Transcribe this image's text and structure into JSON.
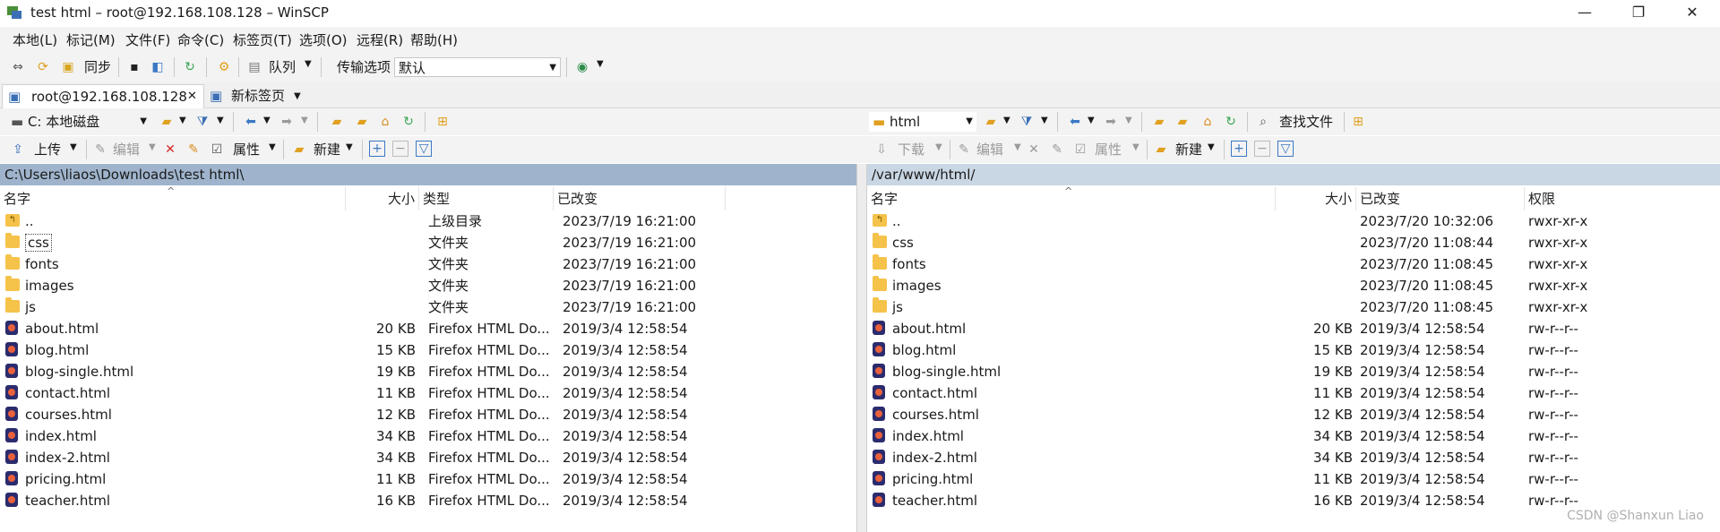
{
  "window": {
    "title": "test html – root@192.168.108.128 – WinSCP",
    "minimize": "—",
    "maximize": "❐",
    "close": "✕"
  },
  "menu": [
    "本地(L)",
    "标记(M)",
    "文件(F)",
    "命令(C)",
    "标签页(T)",
    "选项(O)",
    "远程(R)",
    "帮助(H)"
  ],
  "toolbar": {
    "sync_label": "同步",
    "queue_label": "队列",
    "transfer_label": "传输选项",
    "transfer_value": "默认"
  },
  "tabs": [
    {
      "label": "root@192.168.108.128",
      "close": "✕"
    },
    {
      "label": "新标签页"
    }
  ],
  "local": {
    "drive": "C: 本地磁盘",
    "upload_label": "上传",
    "edit_label": "编辑",
    "properties_label": "属性",
    "new_label": "新建",
    "path": "C:\\Users\\liaos\\Downloads\\test html\\",
    "columns": {
      "name": "名字",
      "size": "大小",
      "type": "类型",
      "changed": "已改变"
    },
    "files": [
      {
        "name": "..",
        "size": "",
        "type": "上级目录",
        "changed": "2023/7/19 16:21:00",
        "kind": "up"
      },
      {
        "name": "css",
        "size": "",
        "type": "文件夹",
        "changed": "2023/7/19 16:21:00",
        "kind": "folder"
      },
      {
        "name": "fonts",
        "size": "",
        "type": "文件夹",
        "changed": "2023/7/19 16:21:00",
        "kind": "folder"
      },
      {
        "name": "images",
        "size": "",
        "type": "文件夹",
        "changed": "2023/7/19 16:21:00",
        "kind": "folder"
      },
      {
        "name": "js",
        "size": "",
        "type": "文件夹",
        "changed": "2023/7/19 16:21:00",
        "kind": "folder"
      },
      {
        "name": "about.html",
        "size": "20 KB",
        "type": "Firefox HTML Do...",
        "changed": "2019/3/4 12:58:54",
        "kind": "html"
      },
      {
        "name": "blog.html",
        "size": "15 KB",
        "type": "Firefox HTML Do...",
        "changed": "2019/3/4 12:58:54",
        "kind": "html"
      },
      {
        "name": "blog-single.html",
        "size": "19 KB",
        "type": "Firefox HTML Do...",
        "changed": "2019/3/4 12:58:54",
        "kind": "html"
      },
      {
        "name": "contact.html",
        "size": "11 KB",
        "type": "Firefox HTML Do...",
        "changed": "2019/3/4 12:58:54",
        "kind": "html"
      },
      {
        "name": "courses.html",
        "size": "12 KB",
        "type": "Firefox HTML Do...",
        "changed": "2019/3/4 12:58:54",
        "kind": "html"
      },
      {
        "name": "index.html",
        "size": "34 KB",
        "type": "Firefox HTML Do...",
        "changed": "2019/3/4 12:58:54",
        "kind": "html"
      },
      {
        "name": "index-2.html",
        "size": "34 KB",
        "type": "Firefox HTML Do...",
        "changed": "2019/3/4 12:58:54",
        "kind": "html"
      },
      {
        "name": "pricing.html",
        "size": "11 KB",
        "type": "Firefox HTML Do...",
        "changed": "2019/3/4 12:58:54",
        "kind": "html"
      },
      {
        "name": "teacher.html",
        "size": "16 KB",
        "type": "Firefox HTML Do...",
        "changed": "2019/3/4 12:58:54",
        "kind": "html"
      }
    ]
  },
  "remote": {
    "dir": "html",
    "find_label": "查找文件",
    "download_label": "下载",
    "edit_label": "编辑",
    "properties_label": "属性",
    "new_label": "新建",
    "path": "/var/www/html/",
    "columns": {
      "name": "名字",
      "size": "大小",
      "changed": "已改变",
      "rights": "权限"
    },
    "files": [
      {
        "name": "..",
        "size": "",
        "changed": "2023/7/20 10:32:06",
        "rights": "rwxr-xr-x",
        "kind": "up"
      },
      {
        "name": "css",
        "size": "",
        "changed": "2023/7/20 11:08:44",
        "rights": "rwxr-xr-x",
        "kind": "folder"
      },
      {
        "name": "fonts",
        "size": "",
        "changed": "2023/7/20 11:08:45",
        "rights": "rwxr-xr-x",
        "kind": "folder"
      },
      {
        "name": "images",
        "size": "",
        "changed": "2023/7/20 11:08:45",
        "rights": "rwxr-xr-x",
        "kind": "folder"
      },
      {
        "name": "js",
        "size": "",
        "changed": "2023/7/20 11:08:45",
        "rights": "rwxr-xr-x",
        "kind": "folder"
      },
      {
        "name": "about.html",
        "size": "20 KB",
        "changed": "2019/3/4 12:58:54",
        "rights": "rw-r--r--",
        "kind": "html"
      },
      {
        "name": "blog.html",
        "size": "15 KB",
        "changed": "2019/3/4 12:58:54",
        "rights": "rw-r--r--",
        "kind": "html"
      },
      {
        "name": "blog-single.html",
        "size": "19 KB",
        "changed": "2019/3/4 12:58:54",
        "rights": "rw-r--r--",
        "kind": "html"
      },
      {
        "name": "contact.html",
        "size": "11 KB",
        "changed": "2019/3/4 12:58:54",
        "rights": "rw-r--r--",
        "kind": "html"
      },
      {
        "name": "courses.html",
        "size": "12 KB",
        "changed": "2019/3/4 12:58:54",
        "rights": "rw-r--r--",
        "kind": "html"
      },
      {
        "name": "index.html",
        "size": "34 KB",
        "changed": "2019/3/4 12:58:54",
        "rights": "rw-r--r--",
        "kind": "html"
      },
      {
        "name": "index-2.html",
        "size": "34 KB",
        "changed": "2019/3/4 12:58:54",
        "rights": "rw-r--r--",
        "kind": "html"
      },
      {
        "name": "pricing.html",
        "size": "11 KB",
        "changed": "2019/3/4 12:58:54",
        "rights": "rw-r--r--",
        "kind": "html"
      },
      {
        "name": "teacher.html",
        "size": "16 KB",
        "changed": "2019/3/4 12:58:54",
        "rights": "rw-r--r--",
        "kind": "html"
      }
    ]
  },
  "colors": {
    "local_path_bg": "#9fb4cc",
    "remote_path_bg": "#c9d6e3"
  },
  "watermark": "CSDN @Shanxun Liao"
}
